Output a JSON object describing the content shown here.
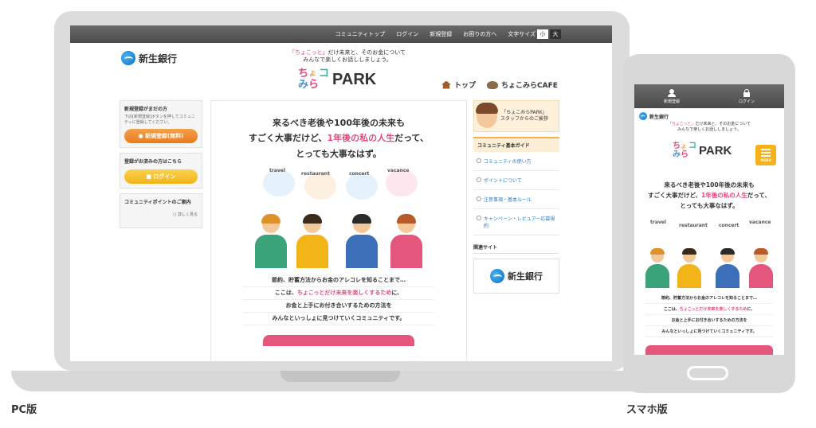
{
  "pc_topbar": {
    "links": [
      "コミュニティトップ",
      "ログイン",
      "新規登録",
      "お困りの方へ",
      "文字サイズ"
    ],
    "font_small": "小",
    "font_large": "大"
  },
  "bank_name": "新生銀行",
  "tagline": {
    "pink": "「ちょこっと」",
    "line1_rest": "だけ未来と、そのお金について",
    "line2": "みんなで楽しくお話ししましょう。"
  },
  "park_logo": {
    "letters": [
      "ち",
      "ょ",
      "コ",
      "み",
      "ら"
    ],
    "word": "PARK"
  },
  "pc_nav": {
    "top": "トップ",
    "cafe": "ちょこみらCAFE"
  },
  "left_col": {
    "register_title": "新規登録がまだの方",
    "register_desc": "下の[新規登録]ボタンを押してコミュニティに登録してください。",
    "register_button": "新規登録(無料)",
    "login_title": "登録がお済みの方はこちら",
    "login_button": "ログイン",
    "points_title": "コミュニティポイントのご案内",
    "points_link": "詳しく見る"
  },
  "hero": {
    "line1": "来るべき老後や100年後の未来も",
    "line2_a": "すごく大事だけど、",
    "line2_b": "1年後の私の人生",
    "line2_c": "だって、",
    "line3": "とっても大事なはず。"
  },
  "bubbles": [
    "travel",
    "restaurant",
    "concert",
    "vacance"
  ],
  "sub": {
    "line1": "節約、貯蓄方法からお金のアレコレを知ることまで…",
    "line2_a": "ここは、",
    "line2_pink": "ちょこっとだけ未来を楽しくするため",
    "line2_b": "に、",
    "line3": "お金と上手にお付き合いするための方法を",
    "line4": "みんなといっしょに見つけていくコミュニティです。"
  },
  "right_col": {
    "staff_line1": "「ちょこみらPARK」",
    "staff_line2": "スタッフからのご挨拶",
    "guide_title": "コミュニティ基本ガイド",
    "guide_items": [
      "コミュニティの使い方",
      "ポイントについて",
      "注意事項・基本ルール",
      "キャンペーン・レビュアー応募規約"
    ],
    "related_title": "関連サイト"
  },
  "phone": {
    "register": "新規登録",
    "login": "ログイン",
    "menu": "MENU"
  },
  "captions": {
    "pc": "PC版",
    "sp": "スマホ版"
  },
  "colors": {
    "pink": "#e8477b",
    "orange": "#e97a1c",
    "yellow": "#f2b418",
    "topbar": "#555555"
  }
}
